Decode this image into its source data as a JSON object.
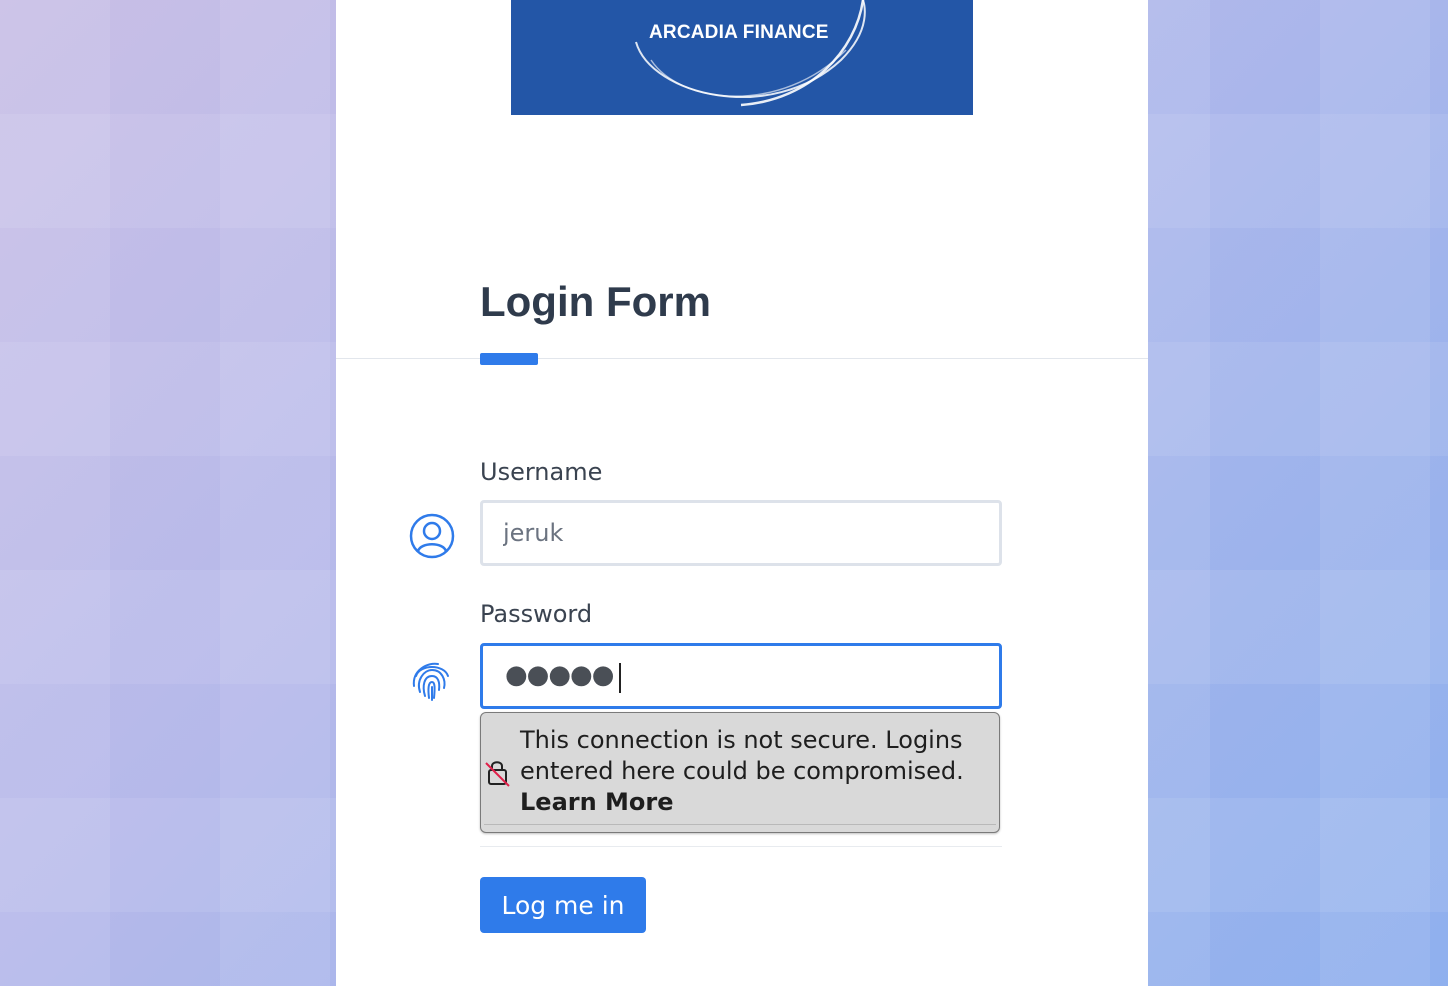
{
  "brand": {
    "logo_text": "ARCADIA FINANCE",
    "logo_color": "#2356a7"
  },
  "form": {
    "title": "Login Form",
    "username": {
      "label": "Username",
      "value": "jeruk",
      "icon": "user-circle-icon"
    },
    "password": {
      "label": "Password",
      "masked_value": "●●●●●",
      "icon": "fingerprint-icon"
    },
    "insecure_warning": {
      "text": "This connection is not secure. Logins entered here could be compromised.",
      "link": "Learn More",
      "icon": "insecure-lock-icon"
    },
    "submit_label": "Log me in"
  },
  "colors": {
    "accent": "#2f7bea",
    "title": "#2f3b4c"
  }
}
